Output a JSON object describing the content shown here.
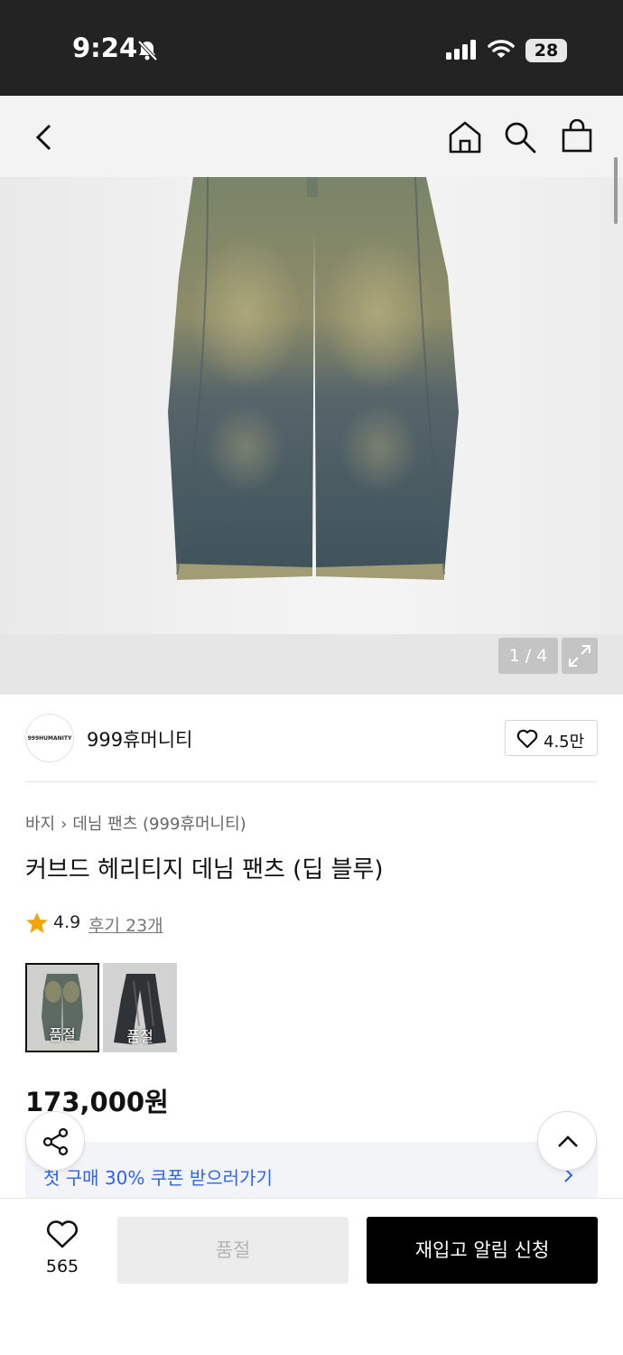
{
  "status": {
    "time": "9:24",
    "battery": "28"
  },
  "gallery": {
    "page_indicator": "1 / 4"
  },
  "brand": {
    "logo_text": "999HUMANITY",
    "name": "999휴머니티",
    "likes": "4.5만"
  },
  "breadcrumb": {
    "category": "바지",
    "subcategory": "데님 팬츠 (999휴머니티)"
  },
  "product": {
    "title": "커브드 헤리티지 데님 팬츠 (딥 블루)",
    "rating": "4.9",
    "reviews_label": "후기 23개",
    "price": "173,000원"
  },
  "variants": [
    {
      "label": "품절",
      "selected": true
    },
    {
      "label": "품절",
      "selected": false
    }
  ],
  "coupon": {
    "label": "첫 구매 30% 쿠폰 받으러가기"
  },
  "bottom": {
    "wish_count": "565",
    "soldout_label": "품절",
    "restock_label": "재입고 알림 신청"
  },
  "colors": {
    "coupon_accent": "#2e64e6",
    "star": "#f4a40b",
    "primary_button": "#000000"
  }
}
